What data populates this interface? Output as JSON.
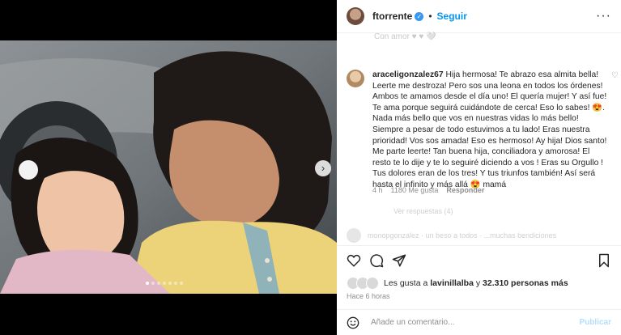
{
  "post": {
    "username": "ftorrente",
    "follow_label": "Seguir",
    "separator": "•",
    "more_label": "···",
    "next_glyph": "›"
  },
  "comments": {
    "faded_top": "Con amor ♥ ♥ 🤍",
    "main": {
      "username": "araceligonzalez67",
      "text": "Hija hermosa! Te abrazo esa almita bella! Leerte me destroza! Pero sos una leona en todos los órdenes! Ambos te amamos desde el día uno! El quería mujer! Y así fue! Te ama porque seguirá cuidándote de cerca! Eso lo sabes! 😍. Nada más bello que vos en nuestras vidas lo más bello! Siempre a pesar de todo estuvimos a tu lado! Eras nuestra prioridad! Vos sos amada! Eso es hermoso! Ay hija! Dios santo! Me parte leerte! Tan buena hija, conciliadora y amorosa! El resto te lo dije y te lo seguiré diciendo a vos ! Eras su Orgullo ! Tus dolores eran de los tres! Y tus triunfos también! Así será hasta el infinito y más allá 😍 mamá",
      "age": "4 h",
      "likes": "1180 Me gusta",
      "reply_label": "Responder"
    },
    "faded_mid": "Ver respuestas (4)",
    "faded_row": "monopgonzalez · un beso a todos · ...muchas bendiciones"
  },
  "likes": {
    "prefix": "Les gusta a",
    "user": "lavinillalba",
    "connector": "y",
    "count": "32.310 personas más"
  },
  "timestamp": "Hace 6 horas",
  "comment_box": {
    "placeholder": "Añade un comentario...",
    "publish_label": "Publicar"
  },
  "colors": {
    "accent": "#0095f6",
    "verified": "#3897f0",
    "muted": "#8e8e8e"
  },
  "icons": [
    "verified-badge-icon",
    "more-options-icon",
    "next-arrow-icon",
    "heart-icon",
    "comment-icon",
    "share-icon",
    "save-icon",
    "emoji-icon"
  ]
}
